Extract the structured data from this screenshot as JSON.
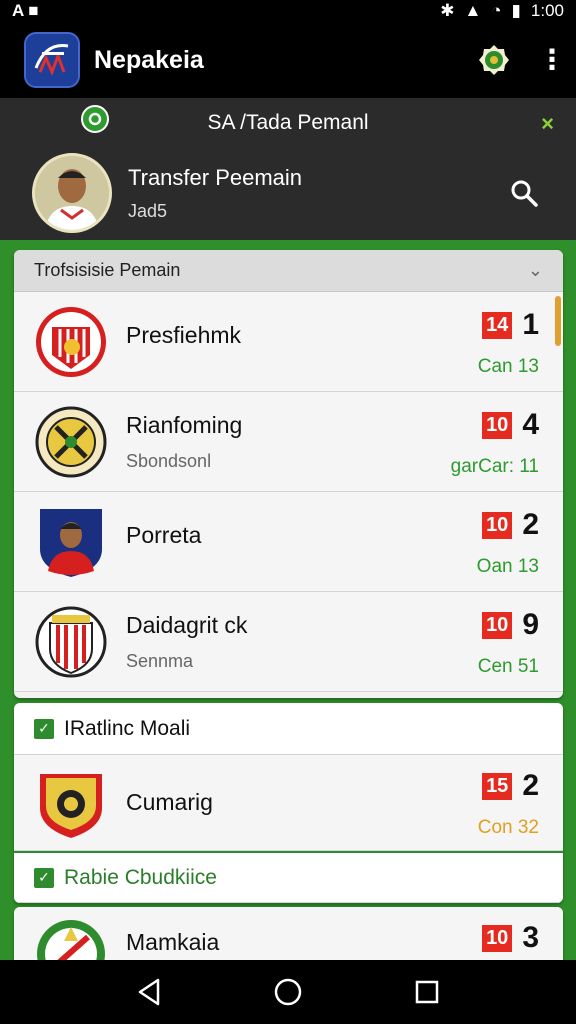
{
  "status_bar": {
    "left_icons": [
      "A",
      "■"
    ],
    "time": "1:00"
  },
  "app": {
    "title": "Nepakeia"
  },
  "subheader": {
    "title": "SA /Tada Pemanl",
    "close_glyph": "×"
  },
  "profile": {
    "name": "Transfer Peemain",
    "sub": "Jad5"
  },
  "section1": {
    "label": "Trofsisisie Pemain",
    "rows": [
      {
        "name": "Presfiehmk",
        "sub": "",
        "score_box": "14",
        "score": "1",
        "stat": "Can 13",
        "stat_color": "#2e9b2e"
      },
      {
        "name": "Rianfoming",
        "sub": "Sbondsonl",
        "score_box": "10",
        "score": "4",
        "stat": "garCar: 11",
        "stat_color": "#2e9b2e"
      },
      {
        "name": "Porreta",
        "sub": "",
        "score_box": "10",
        "score": "2",
        "stat": "Oan 13",
        "stat_color": "#2e9b2e"
      },
      {
        "name": "Daidagrit ck",
        "sub": "Sennma",
        "score_box": "10",
        "score": "9",
        "stat": "Cen 51",
        "stat_color": "#2e9b2e"
      }
    ]
  },
  "section2": {
    "header": "IRatlinc Moali",
    "row": {
      "name": "Cumarig",
      "score_box": "15",
      "score": "2",
      "stat": "Con 32",
      "stat_color": "#e0a020"
    },
    "footer": "Rabie Cbudkiice"
  },
  "section3": {
    "row": {
      "name": "Mamkaia",
      "score_box": "10",
      "score": "3"
    }
  },
  "colors": {
    "accent_green": "#2e8b2e",
    "score_red": "#e52b1f",
    "appbar": "#000000"
  }
}
